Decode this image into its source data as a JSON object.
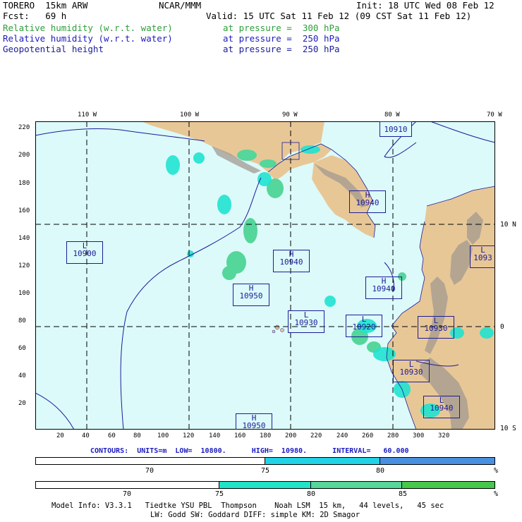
{
  "header": {
    "model": "TORERO  15km ARW",
    "center": "NCAR/MMM",
    "init": "Init: 18 UTC Wed 08 Feb 12",
    "fcst": "Fcst:   69 h",
    "valid": "Valid: 15 UTC Sat 11 Feb 12 (09 CST Sat 11 Feb 12)",
    "fields": [
      {
        "name": "Relative humidity (w.r.t. water)",
        "level": "at pressure =  300 hPa",
        "color": "#2e9e3a"
      },
      {
        "name": "Relative humidity (w.r.t. water)",
        "level": "at pressure =  250 hPa",
        "color": "#1c1cbf"
      },
      {
        "name": "Geopotential height",
        "level": "at pressure =  250 hPa",
        "color": "#1c1c99"
      }
    ]
  },
  "map": {
    "lon_labels": [
      "110 W",
      "100 W",
      "90 W",
      "80 W",
      "70 W"
    ],
    "lat_labels": [
      "10 N",
      "0",
      "10 S"
    ],
    "x_ticks": [
      "20",
      "40",
      "60",
      "80",
      "100",
      "120",
      "140",
      "160",
      "180",
      "200",
      "220",
      "240",
      "260",
      "280",
      "300",
      "320"
    ],
    "y_ticks": [
      "220",
      "200",
      "180",
      "160",
      "140",
      "120",
      "100",
      "80",
      "60",
      "40",
      "20"
    ],
    "colors": {
      "ocean": "#dcfafa",
      "land": "#e8c797",
      "terrain": "#a39a90",
      "rh_300": "#55d69a",
      "rh_250": "#20e3d0",
      "contour": "#1c1c99"
    },
    "boxes": [
      {
        "kind": "H",
        "value": "10910"
      },
      {
        "kind": "H",
        "value": "10940"
      },
      {
        "kind": "L",
        "value": "10900"
      },
      {
        "kind": "H",
        "value": "10940"
      },
      {
        "kind": "H",
        "value": "10940"
      },
      {
        "kind": "H",
        "value": "10950"
      },
      {
        "kind": "L",
        "value": "10930"
      },
      {
        "kind": "L",
        "value": "10920"
      },
      {
        "kind": "L",
        "value": "10930"
      },
      {
        "kind": "L",
        "value": "10930"
      },
      {
        "kind": "L",
        "value": "10940"
      },
      {
        "kind": "L",
        "value": "1093"
      },
      {
        "kind": "H",
        "value": "10950"
      }
    ]
  },
  "contours_line": "CONTOURS:  UNITS=m  LOW=  10800.      HIGH=  10980.      INTERVAL=   60.000",
  "colorbar_250": {
    "labels": [
      "70",
      "75",
      "80",
      "%"
    ],
    "colors": [
      "#ffffff",
      "#20d3e6",
      "#4a90e0"
    ]
  },
  "colorbar_300": {
    "labels": [
      "70",
      "75",
      "80",
      "85",
      "%"
    ],
    "colors": [
      "#ffffff",
      "#20e3c8",
      "#55d69a",
      "#46c84c"
    ]
  },
  "footer": {
    "line1": "Model Info: V3.3.1   Tiedtke YSU PBL  Thompson    Noah LSM  15 km,   44 levels,   45 sec",
    "line2": "LW: Godd SW: Goddard DIFF: simple KM: 2D Smagor"
  }
}
